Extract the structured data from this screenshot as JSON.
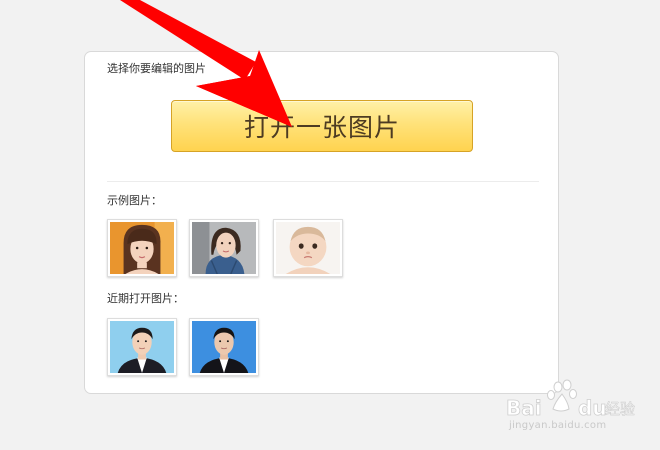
{
  "panel": {
    "choose_label": "选择你要编辑的图片",
    "open_button_label": "打开一张图片",
    "examples_label": "示例图片：",
    "recent_label": "近期打开图片："
  },
  "examples": [
    {
      "icon": "woman-bangs-portrait"
    },
    {
      "icon": "woman-denim-jacket-portrait"
    },
    {
      "icon": "baby-portrait"
    }
  ],
  "recent": [
    {
      "icon": "man-id-photo-light-blue"
    },
    {
      "icon": "man-id-photo-blue"
    }
  ],
  "annotation": {
    "icon": "red-arrow",
    "color": "#ff0000"
  },
  "watermark": {
    "logo": "Baidu经验",
    "url": "jingyan.baidu.com"
  },
  "colors": {
    "button_gradient_top": "#fff1a8",
    "button_gradient_bottom": "#ffd34f",
    "button_text": "#4d3b22",
    "background": "#f2f2f2"
  }
}
